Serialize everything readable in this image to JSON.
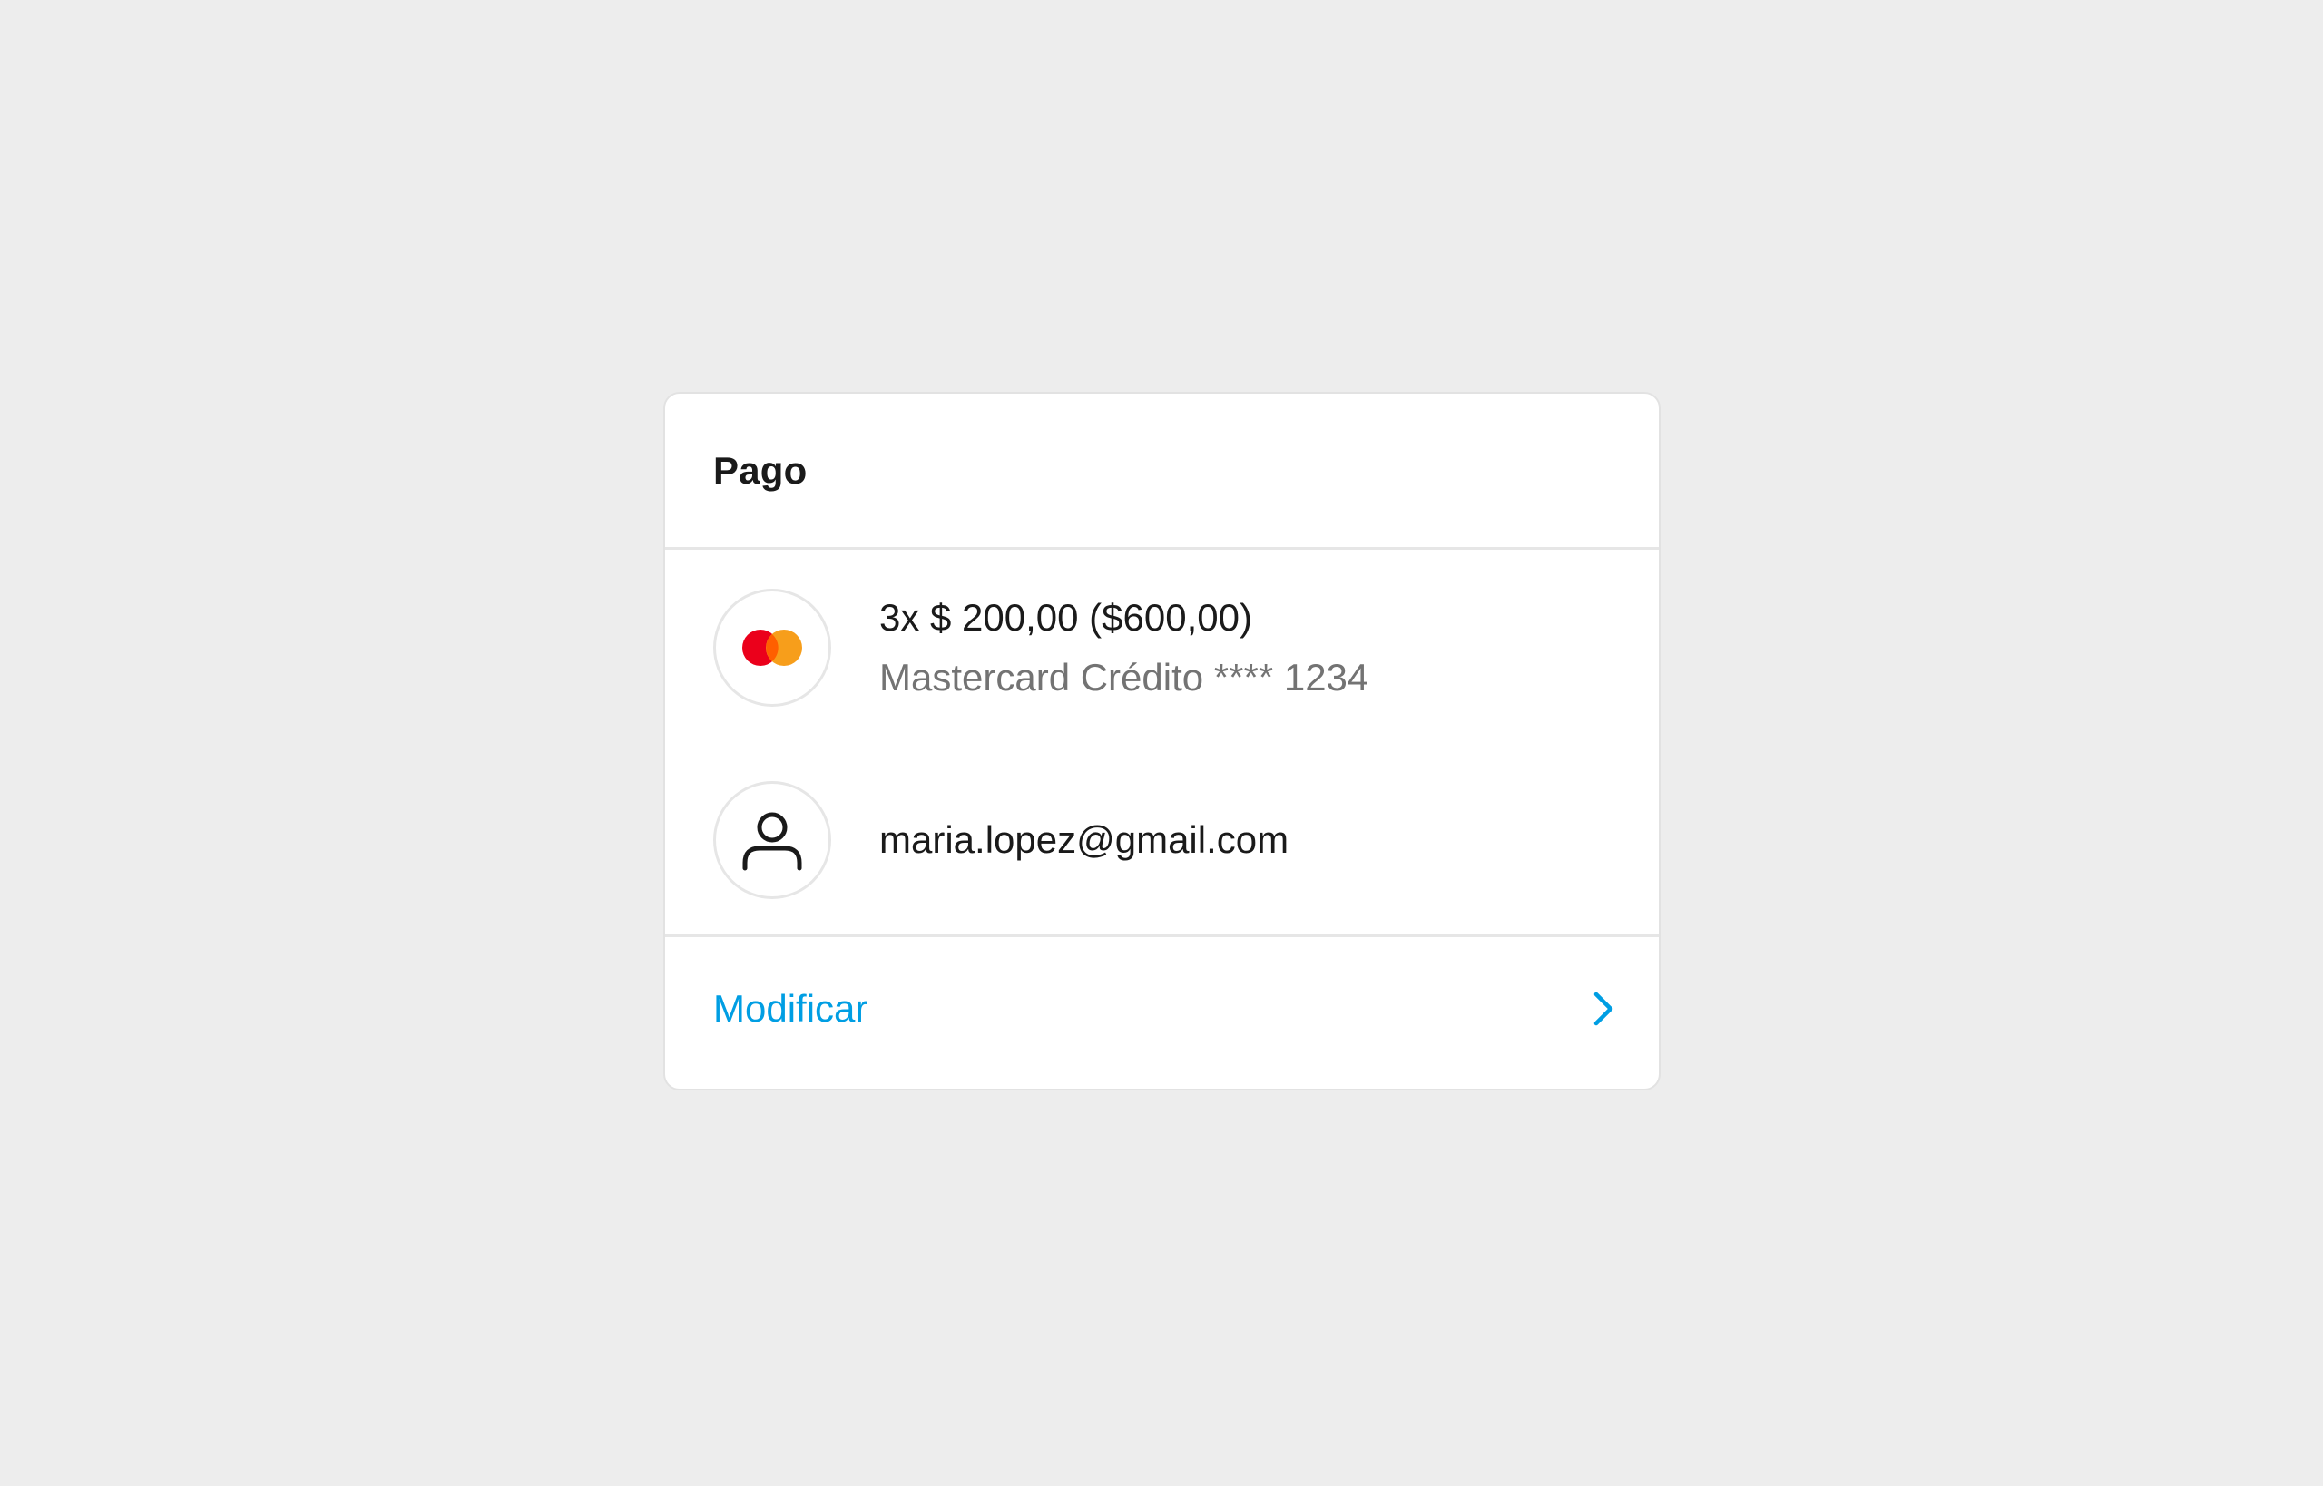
{
  "card": {
    "title": "Pago",
    "payment": {
      "amount": "3x $ 200,00 ($600,00)",
      "method": "Mastercard Crédito **** 1234",
      "icon": "mastercard-logo"
    },
    "user": {
      "email": "maria.lopez@gmail.com",
      "icon": "user-icon"
    },
    "footer": {
      "action_label": "Modificar",
      "icon": "chevron-right-icon"
    }
  },
  "colors": {
    "background": "#ededed",
    "card": "#ffffff",
    "link": "#009ee3",
    "mastercard_red": "#eb001b",
    "mastercard_orange": "#f79e1b"
  }
}
